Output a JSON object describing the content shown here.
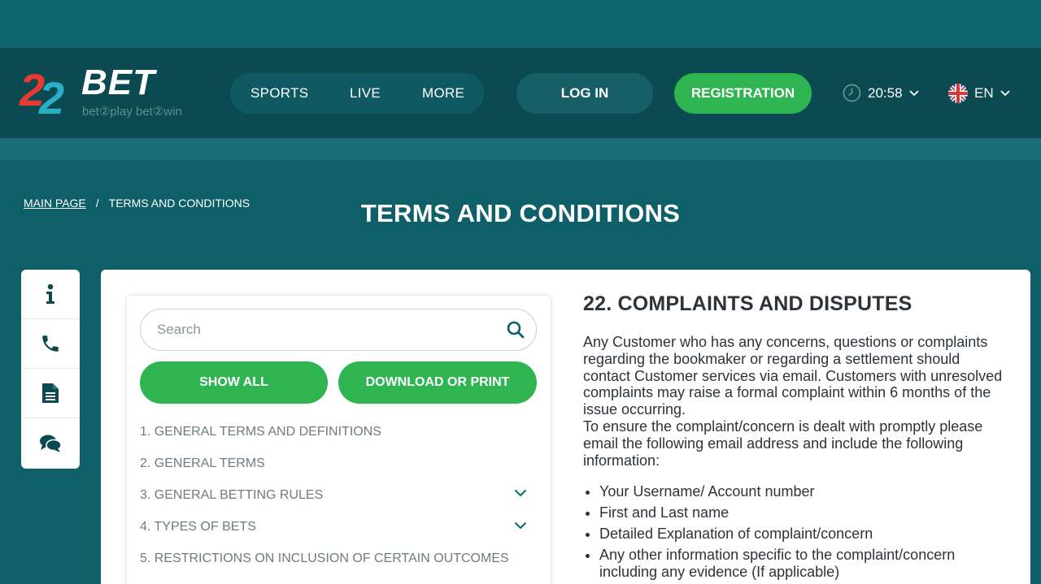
{
  "brand": {
    "logo_number": "22",
    "logo_word": "BET",
    "tagline": "bet②play bet②win",
    "colors": {
      "logo_red": "#e63a33",
      "logo_teal": "#2ab0c6",
      "accent_green": "#2fb452",
      "header_bg": "#0c4a52",
      "page_bg": "#0e5f68"
    }
  },
  "nav": {
    "items": [
      {
        "label": "SPORTS"
      },
      {
        "label": "LIVE"
      },
      {
        "label": "MORE"
      }
    ]
  },
  "auth": {
    "login_label": "LOG IN",
    "register_label": "REGISTRATION"
  },
  "clock": {
    "time": "20:58",
    "icon": "clock-icon"
  },
  "language": {
    "code": "EN",
    "icon": "uk-flag-icon"
  },
  "breadcrumb": {
    "home": "MAIN PAGE",
    "separator": "/",
    "current": "TERMS AND CONDITIONS"
  },
  "page_title": "TERMS AND CONDITIONS",
  "side_menu": {
    "icons": [
      "info-icon",
      "phone-icon",
      "document-icon",
      "chat-icon"
    ]
  },
  "toc": {
    "search_placeholder": "Search",
    "show_all_label": "SHOW ALL",
    "download_label": "DOWNLOAD OR PRINT",
    "items": [
      {
        "label": "1.  GENERAL TERMS AND DEFINITIONS",
        "expandable": false
      },
      {
        "label": "2.  GENERAL TERMS",
        "expandable": false
      },
      {
        "label": "3.  GENERAL BETTING RULES",
        "expandable": true
      },
      {
        "label": "4.  TYPES OF BETS",
        "expandable": true
      },
      {
        "label": "5.  RESTRICTIONS ON INCLUSION OF CERTAIN OUTCOMES",
        "expandable": false
      }
    ]
  },
  "article": {
    "heading": "22. COMPLAINTS AND DISPUTES",
    "paragraph1": "Any Customer who has any concerns, questions or complaints regarding the bookmaker or regarding a settlement should contact Customer services via email. Customers with unresolved complaints may raise a formal complaint within 6 months of the issue occurring.",
    "paragraph2": "To ensure the complaint/concern is dealt with promptly please email the following email address and include the following information:",
    "bullets": [
      "Your Username/ Account number",
      "First and Last name",
      "Detailed Explanation of complaint/concern",
      "Any other information specific to the complaint/concern including any evidence (If applicable)"
    ]
  }
}
